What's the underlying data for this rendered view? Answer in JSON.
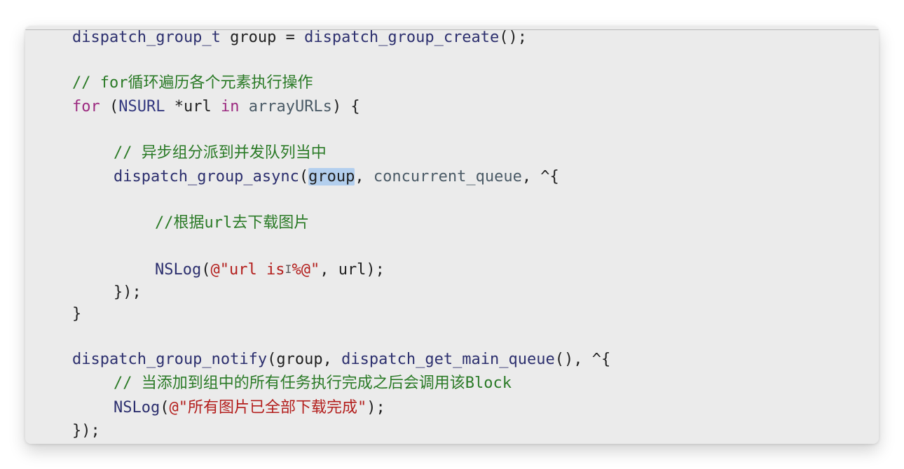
{
  "editor": {
    "language": "objective-c",
    "lines": {
      "l1": {
        "fn1": "dispatch_group_t",
        "mid": " group = ",
        "fn2": "dispatch_group_create",
        "end": "();"
      },
      "l2": {
        "comment": "// for循环遍历各个元素执行操作"
      },
      "l3": {
        "kw1": "for",
        "p1": " (",
        "cls": "NSURL",
        "p2": " *url ",
        "kw2": "in",
        "sp": " ",
        "var": "arrayURLs",
        "end": ") {"
      },
      "l4": {
        "comment": "// 异步组分派到并发队列当中"
      },
      "l5": {
        "fn": "dispatch_group_async",
        "open": "(",
        "selected": "group",
        "comma": ", ",
        "var": "concurrent_queue",
        "end": ", ^{"
      },
      "l6": {
        "comment": "//根据url去下载图片"
      },
      "l7": {
        "fn": "NSLog",
        "open": "(",
        "str1": "@\"url is",
        "str2": "%@\"",
        "end": ", url);"
      },
      "l8": {
        "text": "});"
      },
      "l9": {
        "text": "}"
      },
      "l10": {
        "fn1": "dispatch_group_notify",
        "mid": "(group, ",
        "fn2": "dispatch_get_main_queue",
        "end": "(), ^{"
      },
      "l11": {
        "comment": "// 当添加到组中的所有任务执行完成之后会调用该Block"
      },
      "l12": {
        "fn": "NSLog",
        "open": "(",
        "str": "@\"所有图片已全部下载完成\"",
        "end": ");"
      },
      "l13": {
        "text": "});"
      }
    },
    "selection_text": "group",
    "cursor_glyph": "I"
  },
  "colors": {
    "background": "#ebebeb",
    "function": "#2c2f6e",
    "keyword": "#9c2a80",
    "class": "#33387f",
    "variable": "#4a5a66",
    "comment": "#2a7a26",
    "string": "#b31d1b",
    "selection": "#b3cfee"
  }
}
